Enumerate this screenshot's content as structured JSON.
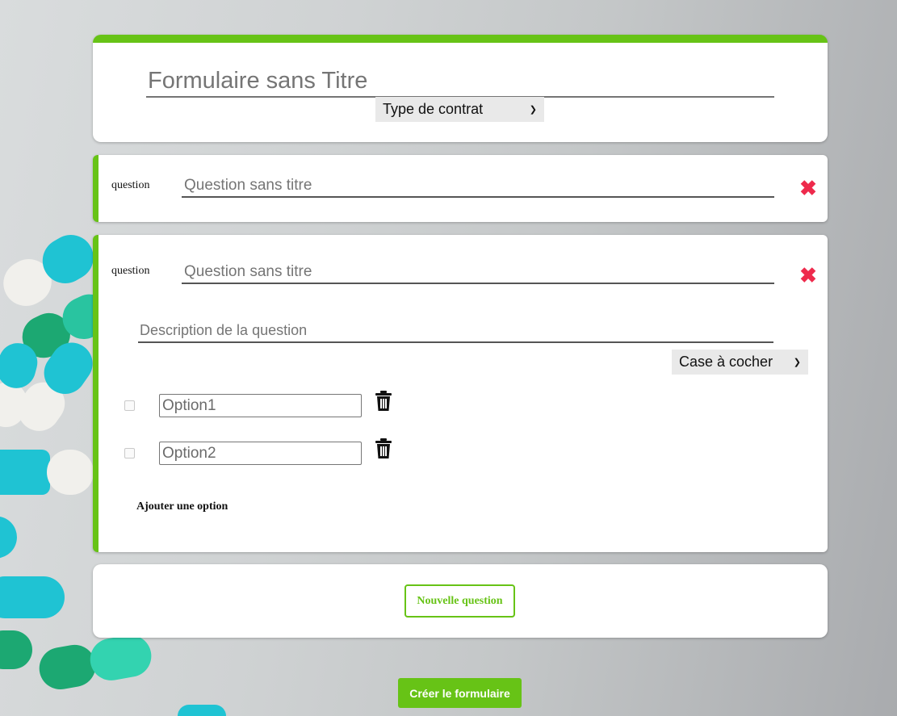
{
  "colors": {
    "accent": "#67c316",
    "delete": "#ee2a4c",
    "capsule_teal": "#1fc3d3",
    "capsule_green": "#22a877"
  },
  "form": {
    "title_placeholder": "Formulaire sans Titre",
    "contract_type": {
      "selected": "Type de contrat"
    }
  },
  "questions": [
    {
      "label": "question",
      "title_placeholder": "Question sans titre",
      "delete_icon": "close-icon"
    },
    {
      "label": "question",
      "title_placeholder": "Question sans titre",
      "delete_icon": "close-icon",
      "description_placeholder": "Description de la question",
      "answer_type": {
        "selected": "Case à cocher"
      },
      "options": [
        {
          "value": "Option1",
          "delete_icon": "trash-icon"
        },
        {
          "value": "Option2",
          "delete_icon": "trash-icon"
        }
      ],
      "add_option_label": "Ajouter une option"
    }
  ],
  "actions": {
    "new_question_label": "Nouvelle question",
    "create_form_label": "Créer le formulaire"
  }
}
